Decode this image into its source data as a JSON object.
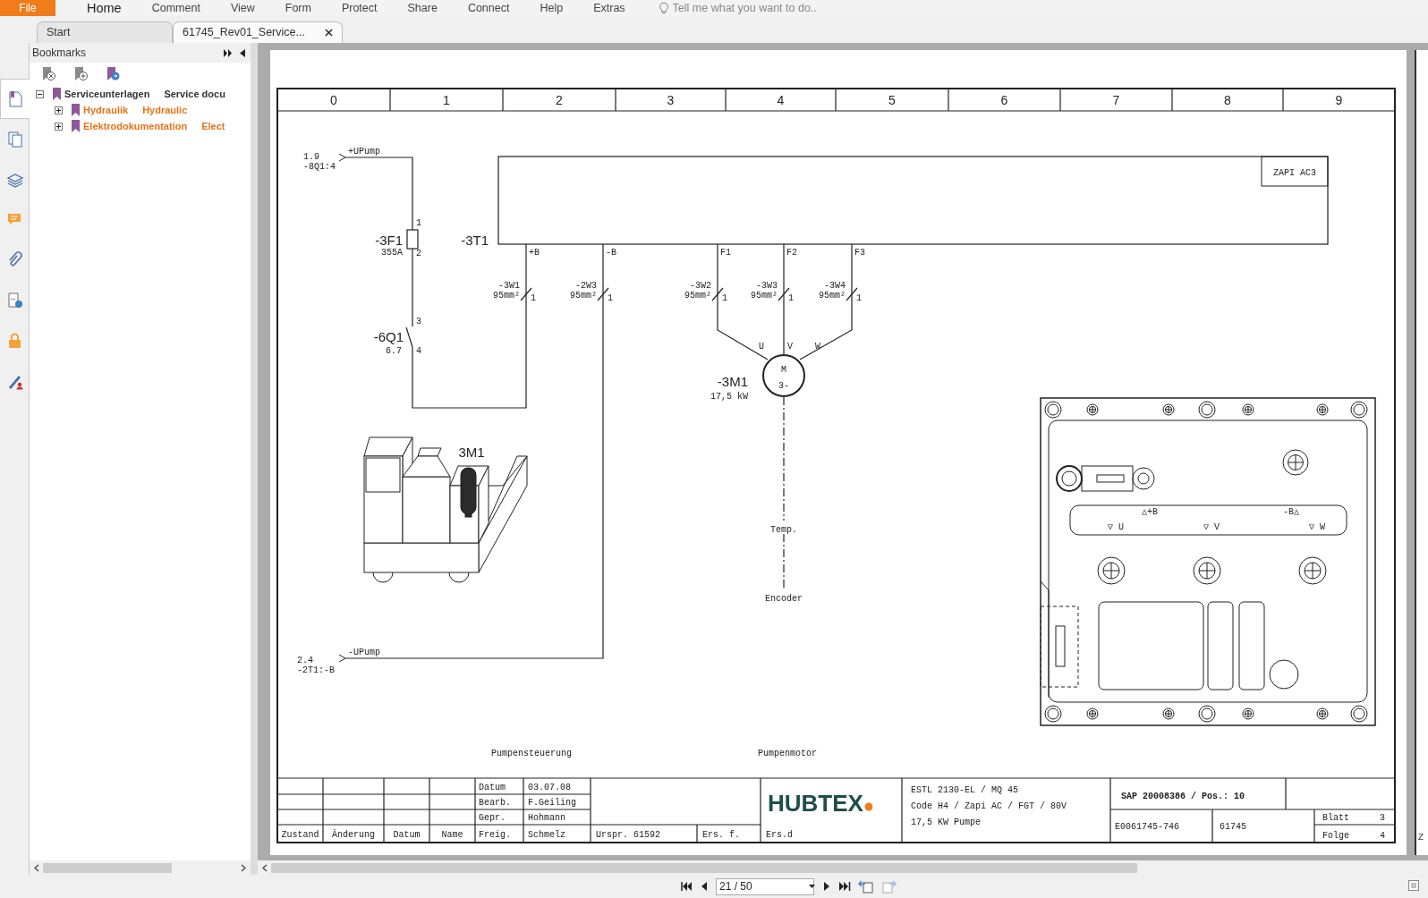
{
  "menu": [
    {
      "label": "File",
      "kind": "app",
      "selected": false
    },
    {
      "label": "Home",
      "kind": "menu",
      "selected": true
    },
    {
      "label": "Comment",
      "kind": "menu",
      "selected": false
    },
    {
      "label": "View",
      "kind": "menu",
      "selected": false
    },
    {
      "label": "Form",
      "kind": "menu",
      "selected": false
    },
    {
      "label": "Protect",
      "kind": "menu",
      "selected": false
    },
    {
      "label": "Share",
      "kind": "menu",
      "selected": false
    },
    {
      "label": "Connect",
      "kind": "menu",
      "selected": false
    },
    {
      "label": "Help",
      "kind": "menu",
      "selected": false
    },
    {
      "label": "Extras",
      "kind": "menu",
      "selected": false
    }
  ],
  "search": {
    "placeholder": "Tell me what you want to do.."
  },
  "tabs": [
    {
      "label": "Start",
      "selected": false,
      "closable": false
    },
    {
      "label": "61745_Rev01_Service...",
      "selected": true,
      "closable": true
    }
  ],
  "side_panel_buttons": [
    {
      "selected": true
    },
    {
      "selected": false
    },
    {
      "selected": false
    },
    {
      "selected": false
    },
    {
      "selected": false
    },
    {
      "selected": false
    },
    {
      "selected": false
    },
    {
      "selected": false
    }
  ],
  "bookmarks": {
    "title": "Bookmarks",
    "items": [
      {
        "label": "Serviceunterlagen",
        "translation": "Service docu",
        "color": "#333333",
        "expanded": true,
        "children": [
          {
            "label": "Hydraulik",
            "translation": "Hydraulic",
            "color": "#e8731a",
            "expanded": false
          },
          {
            "label": "Elektrodokumentation",
            "translation": "Elect",
            "color": "#e8731a",
            "expanded": false
          }
        ]
      }
    ]
  },
  "document": {
    "column_numbers": [
      "0",
      "1",
      "2",
      "3",
      "4",
      "5",
      "6",
      "7",
      "8",
      "9"
    ],
    "pump_supply": {
      "ref": "1.9",
      "source": "-8Q1:4",
      "signal": "+UPump"
    },
    "fuse": {
      "id": "-3F1",
      "rating": "355A",
      "pin_in": "1",
      "pin_out": "2"
    },
    "switch": {
      "id": "-6Q1",
      "ref": "6.7",
      "pin_in": "3",
      "pin_out": "4"
    },
    "controller": {
      "id": "-3T1",
      "model": "ZAPI AC3",
      "terminals": [
        "+B",
        "-B",
        "F1",
        "F2",
        "F3"
      ]
    },
    "cables": [
      {
        "id": "-3W1",
        "section": "95mm²",
        "core": "1"
      },
      {
        "id": "-2W3",
        "section": "95mm²",
        "core": "1"
      },
      {
        "id": "-3W2",
        "section": "95mm²",
        "core": "1"
      },
      {
        "id": "-3W3",
        "section": "95mm²",
        "core": "1"
      },
      {
        "id": "-3W4",
        "section": "95mm²",
        "core": "1"
      }
    ],
    "motor": {
      "id": "-3M1",
      "power": "17,5 kW",
      "symbol": "M",
      "phases": "3-",
      "windings": [
        "U",
        "V",
        "W"
      ],
      "sensors": [
        "Temp.",
        "Encoder"
      ]
    },
    "pump_return": {
      "ref": "2.4",
      "source": "-2T1:-B",
      "signal": "-UPump"
    },
    "truck": {
      "label": "3M1"
    },
    "controller_drawing": {
      "terminals": [
        "△+B",
        "-B△"
      ],
      "phases": [
        "▽ U",
        "▽ V",
        "▽ W"
      ]
    },
    "section_titles": [
      "Pumpensteuerung",
      "Pumpenmotor"
    ],
    "title_block": {
      "revision_headers": [
        "Zustand",
        "Änderung",
        "Datum",
        "Name"
      ],
      "approvals": [
        {
          "role": "Datum",
          "value": "03.07.08"
        },
        {
          "role": "Bearb.",
          "value": "F.Geiling"
        },
        {
          "role": "Gepr.",
          "value": "Hohmann"
        },
        {
          "role": "Freig.",
          "value": "Schmelz"
        }
      ],
      "origin": "Urspr. 61592",
      "replaces": "Ers. f.",
      "replaced_by": "Ers.d",
      "logo": "HUBTEX",
      "description": [
        "ESTL 2130-EL / MQ 45",
        "Code H4 / Zapi AC / FGT / 80V",
        "17,5 KW Pumpe"
      ],
      "sap": "SAP 20008386 / Pos.: 10",
      "drawing_number": "E0061745-746",
      "project": "61745",
      "sheet_label": "Blatt",
      "sheet": "3",
      "next_label": "Folge",
      "next": "4"
    }
  },
  "next_page": {
    "text": "Z"
  },
  "navigation": {
    "page_field": "21 / 50"
  }
}
